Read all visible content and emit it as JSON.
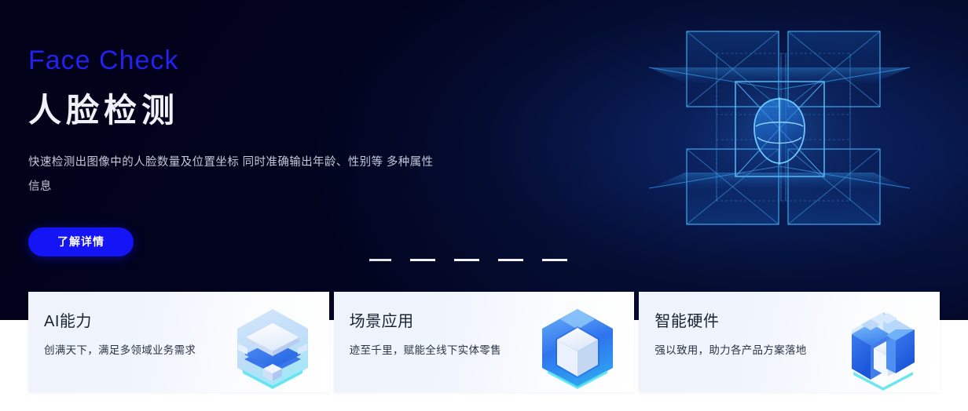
{
  "hero": {
    "eyebrow": "Face Check",
    "headline": "人脸检测",
    "description": "快速检测出图像中的人脸数量及位置坐标 同时准确输出年龄、性别等 多种属性信息",
    "cta_label": "了解详情",
    "art_name": "face-detection-wireframe",
    "background_color": "#02021a",
    "accent_color": "#2222ee",
    "cta_color": "#1414f5"
  },
  "carousel": {
    "count": 5,
    "active_index": 0,
    "slides": [
      {
        "label": "slide-1"
      },
      {
        "label": "slide-2"
      },
      {
        "label": "slide-3"
      },
      {
        "label": "slide-4"
      },
      {
        "label": "slide-5"
      }
    ]
  },
  "cards": [
    {
      "title": "AI能力",
      "description": "创满天下，满足多领域业务需求",
      "icon": "layered-cube-icon"
    },
    {
      "title": "场景应用",
      "description": "迹至千里，赋能全线下实体零售",
      "icon": "hex-cube-icon"
    },
    {
      "title": "智能硬件",
      "description": "强以致用，助力各产品方案落地",
      "icon": "server-blocks-icon"
    }
  ]
}
